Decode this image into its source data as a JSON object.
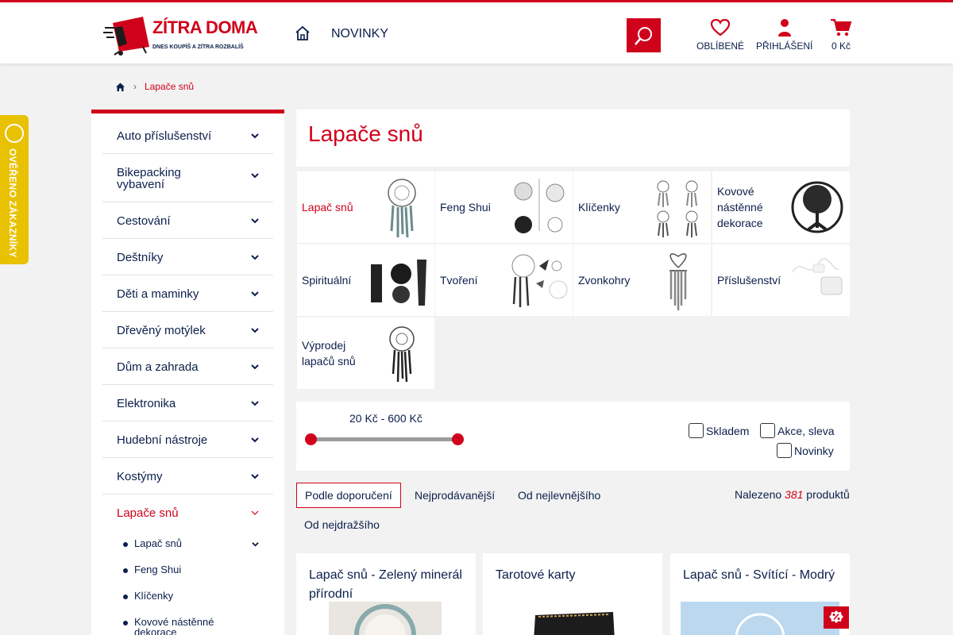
{
  "colors": {
    "brand_red": "#d0021b",
    "navy": "#0b1f4b",
    "badge_yellow": "#e8c100",
    "background": "#f2f2f2"
  },
  "header": {
    "logo_text": "ZÍTRA DOMA",
    "logo_tagline": "DNES KOUPÍŠ A ZÍTRA ROZBALÍŠ",
    "home_icon": "home-icon",
    "nav_new": "NOVINKY",
    "search_icon": "search-icon",
    "favorites_label": "OBLÍBENÉ",
    "login_label": "PŘIHLÁŠENÍ",
    "cart_label": "0 Kč"
  },
  "breadcrumb": {
    "home_icon": "home-icon",
    "current": "Lapače snů"
  },
  "badge": {
    "text": "OVĚŘENO ZÁKAZNÍKY"
  },
  "sidebar": {
    "categories": [
      {
        "label": "Auto příslušenství"
      },
      {
        "label": "Bikepacking vybavení"
      },
      {
        "label": "Cestování"
      },
      {
        "label": "Deštníky"
      },
      {
        "label": "Děti a maminky"
      },
      {
        "label": "Dřevěný motýlek"
      },
      {
        "label": "Dům a zahrada"
      },
      {
        "label": "Elektronika"
      },
      {
        "label": "Hudební nástroje"
      },
      {
        "label": "Kostýmy"
      },
      {
        "label": "Lapače snů"
      }
    ],
    "subcategories": [
      {
        "label": "Lapač snů"
      },
      {
        "label": "Feng Shui"
      },
      {
        "label": "Klíčenky"
      },
      {
        "label": "Kovové nástěnné dekorace"
      }
    ]
  },
  "page": {
    "title": "Lapače snů"
  },
  "tiles": [
    {
      "label": "Lapač snů"
    },
    {
      "label": "Feng Shui"
    },
    {
      "label": "Klíčenky"
    },
    {
      "label": "Kovové nástěnné dekorace"
    },
    {
      "label": "Spirituální"
    },
    {
      "label": "Tvoření"
    },
    {
      "label": "Zvonkohry"
    },
    {
      "label": "Příslušenství"
    },
    {
      "label": "Výprodej lapačů snů"
    }
  ],
  "filters": {
    "price_range": "20 Kč - 600 Kč",
    "price_min": 20,
    "price_max": 600,
    "in_stock": "Skladem",
    "sale": "Akce, sleva",
    "news": "Novinky"
  },
  "sort": {
    "options": [
      "Podle doporučení",
      "Nejprodávanější",
      "Od nejlevnějšího",
      "Od nejdražšího"
    ],
    "active": "Podle doporučení"
  },
  "results": {
    "prefix": "Nalezeno",
    "count": "381",
    "suffix": "produktů"
  },
  "products": [
    {
      "name": "Lapač snů - Zelený minerál přírodní"
    },
    {
      "name": "Tarotové karty"
    },
    {
      "name": "Lapač snů - Svítící - Modrý",
      "badge": "%"
    }
  ]
}
